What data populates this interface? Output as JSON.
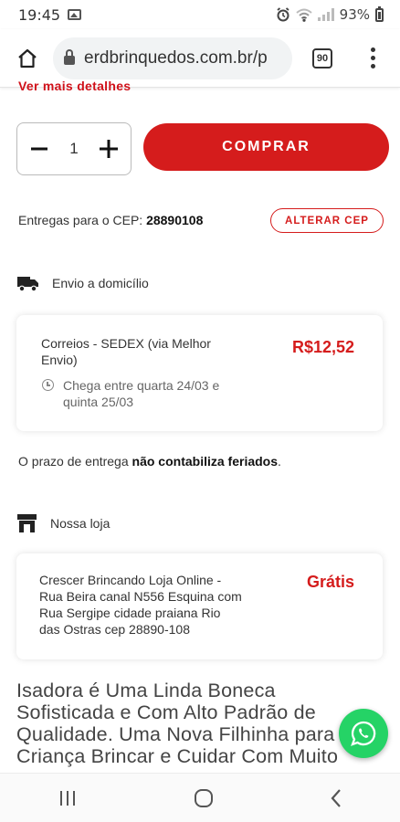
{
  "status_bar": {
    "time": "19:45",
    "battery": "93%"
  },
  "browser": {
    "url": "erdbrinquedos.com.br/p",
    "tab_count": "90"
  },
  "product": {
    "partial_link": "Ver mais detalhes",
    "quantity": "1",
    "buy_label": "COMPRAR",
    "accent_color": "#d51c1c"
  },
  "shipping": {
    "cep_prefix": "Entregas para o CEP:",
    "cep_value": "28890108",
    "change_cep_label": "ALTERAR CEP",
    "home_delivery": {
      "heading": "Envio a domicílio",
      "carrier_line1": "Correios - SEDEX (via Melhor",
      "carrier_line2": "Envio)",
      "price": "R$12,52",
      "eta_line1": "Chega entre quarta 24/03 e",
      "eta_line2": "quinta 25/03"
    },
    "prazo_prefix": "O prazo de entrega",
    "prazo_bold": "não contabiliza feriados",
    "prazo_suffix": ".",
    "store": {
      "heading": "Nossa loja",
      "line1": "Crescer Brincando Loja Online -",
      "line2": "Rua Beira canal N556 Esquina com",
      "line3": "Rua Sergipe cidade praiana Rio",
      "line4": "das Ostras cep 28890-108",
      "price": "Grátis"
    }
  },
  "description": {
    "line1": "Isadora é Uma Linda Boneca",
    "line2": "Sofisticada e Com Alto Padrão de",
    "line3": "Qualidade. Uma Nova Filhinha para",
    "line4": "Criança Brincar e Cuidar Com Muito"
  }
}
